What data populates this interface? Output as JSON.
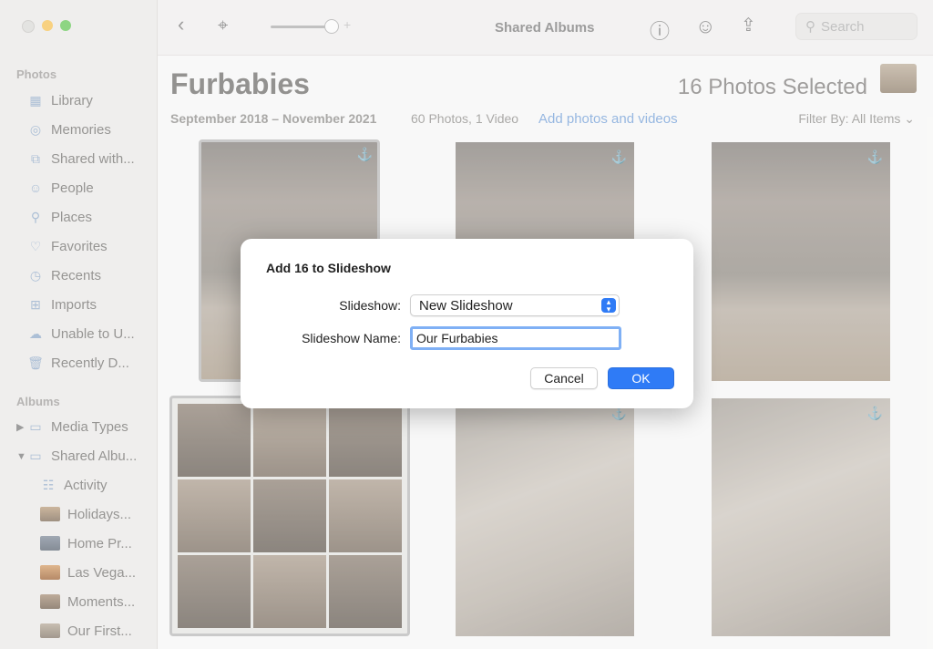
{
  "sidebar": {
    "photos_section": "Photos",
    "albums_section": "Albums",
    "photo_items": [
      {
        "label": "Library",
        "icon": "library-icon"
      },
      {
        "label": "Memories",
        "icon": "memories-icon"
      },
      {
        "label": "Shared with...",
        "icon": "shared-with-icon"
      },
      {
        "label": "People",
        "icon": "people-icon"
      },
      {
        "label": "Places",
        "icon": "places-icon"
      },
      {
        "label": "Favorites",
        "icon": "favorites-icon"
      },
      {
        "label": "Recents",
        "icon": "recents-icon"
      },
      {
        "label": "Imports",
        "icon": "imports-icon"
      },
      {
        "label": "Unable to U...",
        "icon": "unable-to-upload-icon"
      },
      {
        "label": "Recently D...",
        "icon": "recently-deleted-icon"
      }
    ],
    "album_items": [
      {
        "label": "Media Types",
        "icon": "media-types-icon"
      },
      {
        "label": "Shared Albu...",
        "icon": "shared-albums-icon"
      }
    ],
    "shared_sub": [
      {
        "label": "Activity"
      },
      {
        "label": "Holidays..."
      },
      {
        "label": "Home Pr..."
      },
      {
        "label": "Las Vega..."
      },
      {
        "label": "Moments..."
      },
      {
        "label": "Our First..."
      }
    ]
  },
  "toolbar": {
    "title": "Shared Albums",
    "search_placeholder": "Search"
  },
  "album": {
    "title": "Furbabies",
    "selected": "16 Photos Selected",
    "dates": "September 2018 – November 2021",
    "counts": "60 Photos, 1 Video",
    "add_link": "Add photos and videos",
    "filter": "Filter By: All Items"
  },
  "dialog": {
    "title": "Add 16 to Slideshow",
    "slideshow_label": "Slideshow:",
    "slideshow_value": "New Slideshow",
    "name_label": "Slideshow Name:",
    "name_value": "Our Furbabies",
    "cancel": "Cancel",
    "ok": "OK"
  },
  "colors": {
    "accent": "#2f7bf6",
    "link": "#6e9bd6",
    "sidebar_bg": "#e9e8e6"
  }
}
